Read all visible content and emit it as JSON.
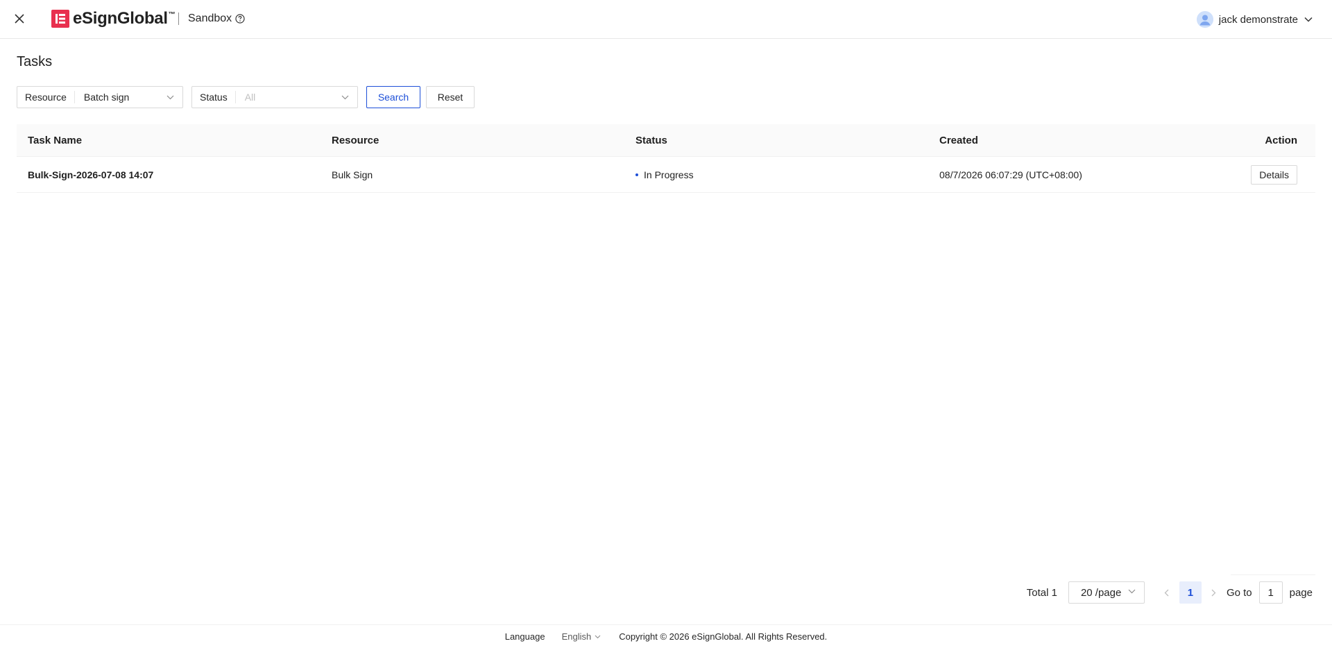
{
  "header": {
    "close_icon": "close-icon",
    "logo_text": "eSignGlobal",
    "logo_tm": "™",
    "environment": "Sandbox",
    "help_icon": "question-circle-icon",
    "user_name": "jack demonstrate",
    "user_chevron_icon": "chevron-down-icon",
    "brand_color": "#e8304f"
  },
  "page": {
    "title": "Tasks"
  },
  "filters": {
    "resource_label": "Resource",
    "resource_value": "Batch sign",
    "status_label": "Status",
    "status_placeholder": "All",
    "search_label": "Search",
    "reset_label": "Reset",
    "accent_color": "#1d4fd8"
  },
  "table": {
    "columns": [
      "Task Name",
      "Resource",
      "Status",
      "Created",
      "Action"
    ],
    "rows": [
      {
        "task_name": "Bulk-Sign-2026-07-08 14:07",
        "resource": "Bulk Sign",
        "status": "In Progress",
        "created": "08/7/2026 06:07:29 (UTC+08:00)",
        "action": "Details"
      }
    ]
  },
  "pagination": {
    "total": "Total 1",
    "page_size": "20 /page",
    "current_page": "1",
    "goto_label": "Go to",
    "goto_value": "1",
    "page_label": "page"
  },
  "footer": {
    "language_label": "Language",
    "language_value": "English",
    "copyright": "Copyright © 2026 eSignGlobal. All Rights Reserved."
  }
}
